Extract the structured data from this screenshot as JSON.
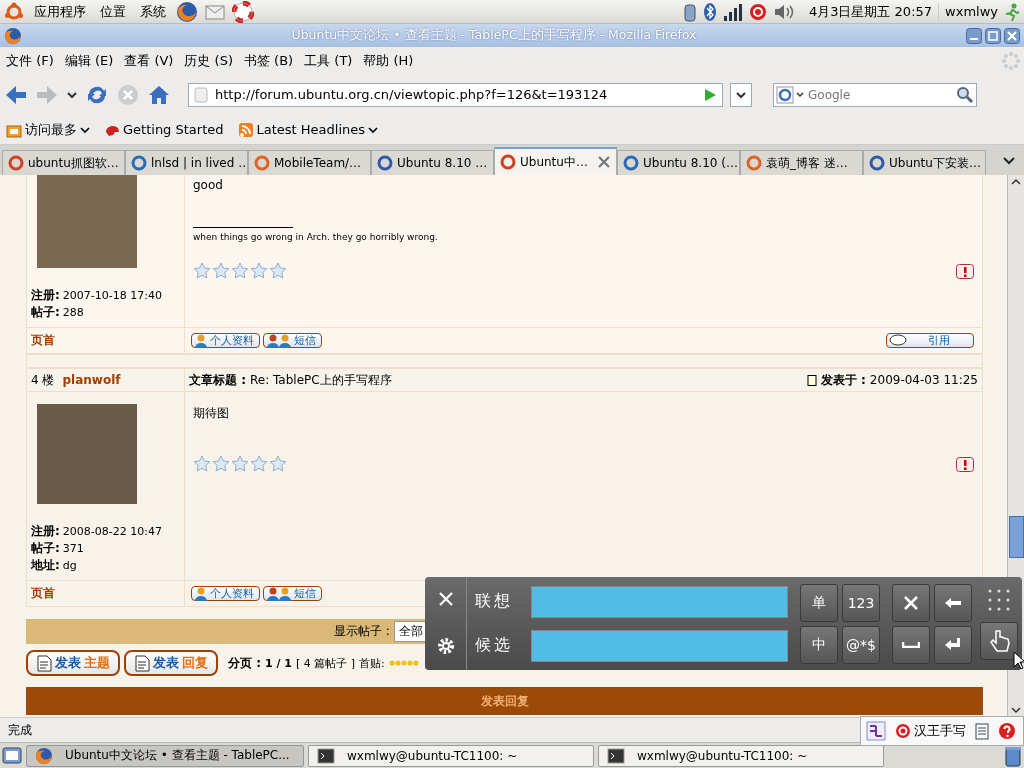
{
  "panel": {
    "menus": [
      "应用程序",
      "位置",
      "系统"
    ],
    "clock": "4月3日星期五 20:57",
    "user": "wxmlwy"
  },
  "window": {
    "title": "Ubuntu中文论坛 • 查看主题 - TablePC上的手写程序 - Mozilla Firefox"
  },
  "menu": [
    "文件 (F)",
    "编辑 (E)",
    "查看 (V)",
    "历史 (S)",
    "书签 (B)",
    "工具 (T)",
    "帮助 (H)"
  ],
  "nav": {
    "url": "http://forum.ubuntu.org.cn/viewtopic.php?f=126&t=193124",
    "search_placeholder": "Google"
  },
  "bookmarks": [
    "访问最多",
    "Getting Started",
    "Latest Headlines"
  ],
  "tabs": [
    {
      "label": "ubuntu抓图软…",
      "selected": false
    },
    {
      "label": "lnlsd | in lived …",
      "selected": false
    },
    {
      "label": "MobileTeam/…",
      "selected": false
    },
    {
      "label": "Ubuntu 8.10 …",
      "selected": false
    },
    {
      "label": "Ubuntu中…",
      "selected": true
    },
    {
      "label": "Ubuntu 8.10 (…",
      "selected": false
    },
    {
      "label": "袁萌_博客 迷…",
      "selected": false
    },
    {
      "label": "Ubuntu下安装…",
      "selected": false
    }
  ],
  "posts": [
    {
      "body": "good",
      "signature": "when things go wrong in Arch. they go horribly wrong.",
      "stars": 0,
      "info": [
        {
          "label": "注册:",
          "value": "2007-10-18 17:40"
        },
        {
          "label": "帖子:",
          "value": "288"
        }
      ],
      "top_link": "页首",
      "buttons": [
        "个人资料",
        "短信"
      ],
      "quote": "引用"
    },
    {
      "floor": "4 楼",
      "author": "planwolf",
      "subject_label": "文章标题 :",
      "subject": "Re: TablePC上的手写程序",
      "posted_label": "发表于 :",
      "posted": "2009-04-03 11:25",
      "body": "期待图",
      "stars": 0,
      "info": [
        {
          "label": "注册:",
          "value": "2008-08-22 10:47"
        },
        {
          "label": "帖子:",
          "value": "371"
        },
        {
          "label": "地址:",
          "value": "dg"
        }
      ],
      "top_link": "页首",
      "buttons": [
        "个人资料",
        "短信"
      ]
    }
  ],
  "display": {
    "label": "显示帖子 :",
    "value": "全部"
  },
  "actions": [
    {
      "first": "发表",
      "second": "主题"
    },
    {
      "first": "发表",
      "second": "回复"
    }
  ],
  "pagination": {
    "label": "分页 :",
    "pages": "1 / 1",
    "count": "[ 4 篇帖子 ]",
    "first_post": "首贴:"
  },
  "reply_bar": "发表回复",
  "status": "完成",
  "ime": {
    "rows": [
      "联想",
      "候选"
    ],
    "keys": [
      "单",
      "123",
      "中",
      "@*$"
    ]
  },
  "scim": {
    "label": "汉王手写"
  },
  "taskbar": [
    {
      "label": "Ubuntu中文论坛 • 查看主题 - TablePC...",
      "selected": true
    },
    {
      "label": "wxmlwy@ubuntu-TC1100: ~",
      "selected": false
    },
    {
      "label": "wxmlwy@ubuntu-TC1100: ~",
      "selected": false
    }
  ]
}
